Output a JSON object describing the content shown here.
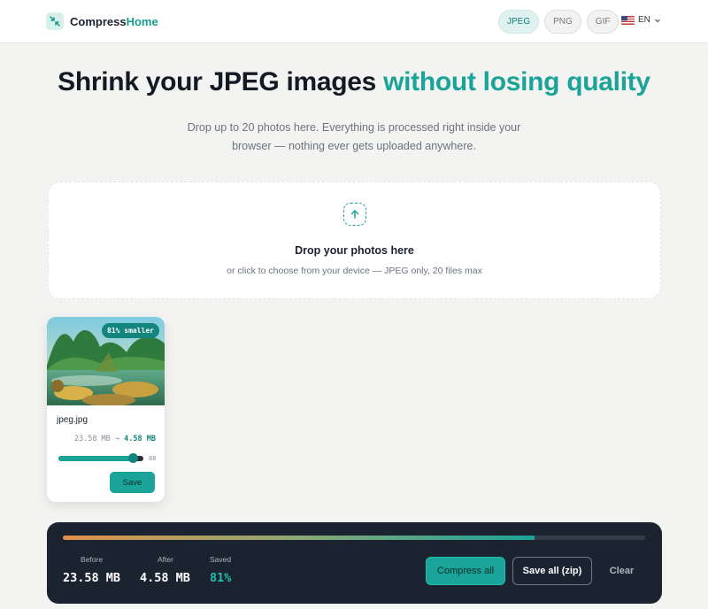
{
  "header": {
    "brand_name_part1": "Compress",
    "brand_name_part2": "Home",
    "format_tabs": [
      "JPEG",
      "PNG",
      "GIF"
    ],
    "active_format": "JPEG",
    "language": "EN",
    "language_flag": "us-flag-icon"
  },
  "hero": {
    "title_main": "Shrink your JPEG images",
    "title_highlight": "without losing quality",
    "subtitle": "Drop up to 20 photos here. Everything is processed right inside your browser — nothing ever gets uploaded anywhere."
  },
  "dropzone": {
    "icon": "upload-icon",
    "title": "Drop your photos here",
    "hint": "or click to choose from your device — JPEG only, 20 files max"
  },
  "files": [
    {
      "name": "jpeg.jpg",
      "badge": "81% smaller",
      "original_size": "23.58 MB",
      "arrow": "→",
      "compressed_size": "4.58 MB",
      "quality": 88,
      "save_label": "Save"
    }
  ],
  "summary": {
    "progress_fraction": 0.81,
    "before_label": "Before",
    "before_value": "23.58 MB",
    "after_label": "After",
    "after_value": "4.58 MB",
    "saved_label": "Saved",
    "saved_value": "81%",
    "compress_all_label": "Compress all",
    "save_zip_label": "Save all (zip)",
    "clear_label": "Clear"
  },
  "colors": {
    "accent": "#1aa398",
    "dark_panel": "#1c2330",
    "badge": "#13857c"
  }
}
